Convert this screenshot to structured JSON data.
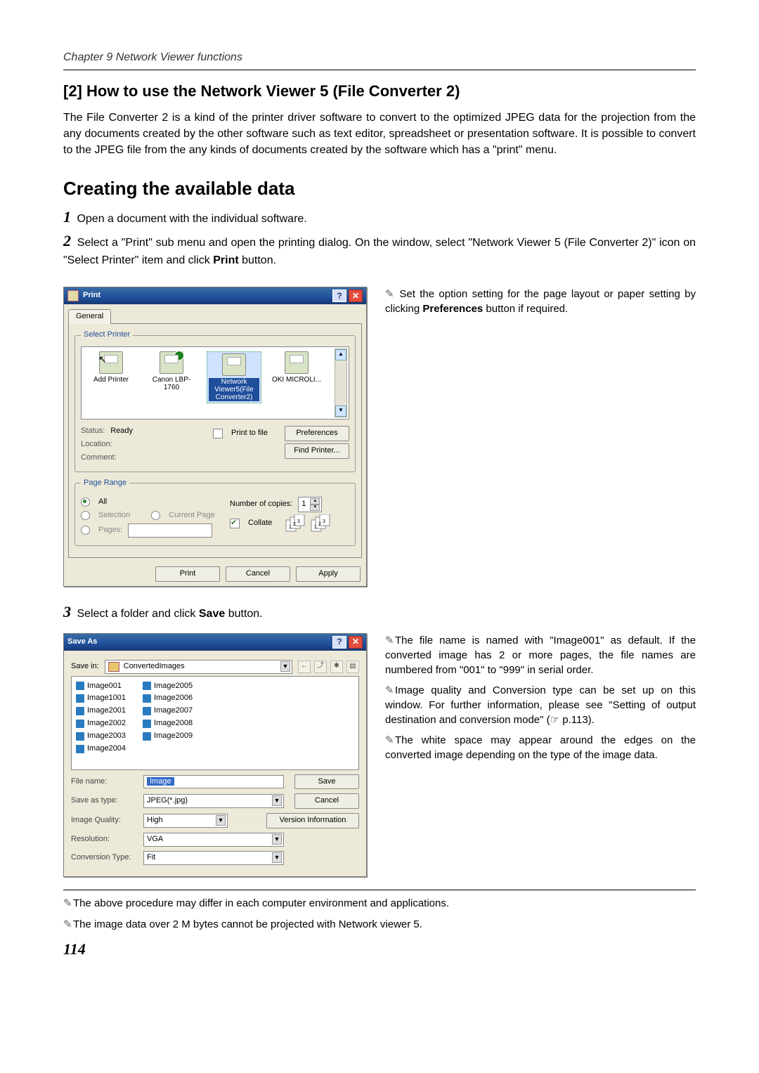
{
  "header": "Chapter 9 Network Viewer functions",
  "section_title": "[2] How to use the Network Viewer 5 (File Converter 2)",
  "intro": "The File Converter 2 is a kind of the printer driver software to convert to the optimized JPEG data for the projection from the any documents created by the other software such as text editor, spreadsheet or presentation software. It is possible to convert to the JPEG file from the any kinds of documents created by the software which has a \"print\" menu.",
  "subhead": "Creating the available data",
  "steps": {
    "s1": "Open a document with the individual software.",
    "s2a": "Select a \"Print\" sub menu and open the printing dialog. On the window, select \"Network Viewer 5 (File Converter 2)\" icon on \"Select Printer\" item and click ",
    "s2b": "Print",
    "s2c": " button.",
    "s3a": "Select a folder and click ",
    "s3b": "Save",
    "s3c": " button."
  },
  "note_pref_a": "Set the option setting for the page layout or paper setting by clicking ",
  "note_pref_b": "Preferences",
  "note_pref_c": " button if required.",
  "print_dialog": {
    "title": "Print",
    "tab": "General",
    "group_select_printer": "Select Printer",
    "printers": {
      "add": "Add Printer",
      "canon": "Canon LBP-1760",
      "nv5": "Network Viewer5(File Converter2)",
      "oki": "OKI MICROLI..."
    },
    "status_label": "Status:",
    "status_val": "Ready",
    "location_label": "Location:",
    "comment_label": "Comment:",
    "print_to_file": "Print to file",
    "btn_pref": "Preferences",
    "btn_find": "Find Printer...",
    "group_page_range": "Page Range",
    "opt_all": "All",
    "opt_selection": "Selection",
    "opt_current": "Current Page",
    "opt_pages": "Pages:",
    "copies_label": "Number of copies:",
    "copies_val": "1",
    "collate": "Collate",
    "btn_print": "Print",
    "btn_cancel": "Cancel",
    "btn_apply": "Apply"
  },
  "saveas": {
    "title": "Save As",
    "savein_label": "Save in:",
    "savein_val": "ConvertedImages",
    "files": [
      "Image001",
      "Image1001",
      "Image2001",
      "Image2002",
      "Image2003",
      "Image2004",
      "Image2005",
      "Image2006",
      "Image2007",
      "Image2008",
      "Image2009"
    ],
    "filename_label": "File name:",
    "filename_val": "Image",
    "saveastype_label": "Save as type:",
    "saveastype_val": "JPEG(*.jpg)",
    "quality_label": "Image Quality:",
    "quality_val": "High",
    "resolution_label": "Resolution:",
    "resolution_val": "VGA",
    "convtype_label": "Conversion Type:",
    "convtype_val": "Fit",
    "btn_save": "Save",
    "btn_cancel": "Cancel",
    "btn_ver": "Version Information"
  },
  "side_notes": {
    "n1": "The file name is named with \"Image001\" as  default. If the converted image has 2 or more pages, the file names are numbered from \"001\" to \"999\" in serial order.",
    "n2": "Image quality and Conversion type can be set up on this window. For further information, please see \"Setting of output destination and conversion mode\" (☞ p.113).",
    "n3": "The white space may appear around the edges on the converted image depending on the type of the image data."
  },
  "footnotes": {
    "f1": "The above procedure may differ in each computer environment and applications.",
    "f2": "The image data over 2 M bytes cannot be projected with Network viewer 5."
  },
  "page_number": "114"
}
